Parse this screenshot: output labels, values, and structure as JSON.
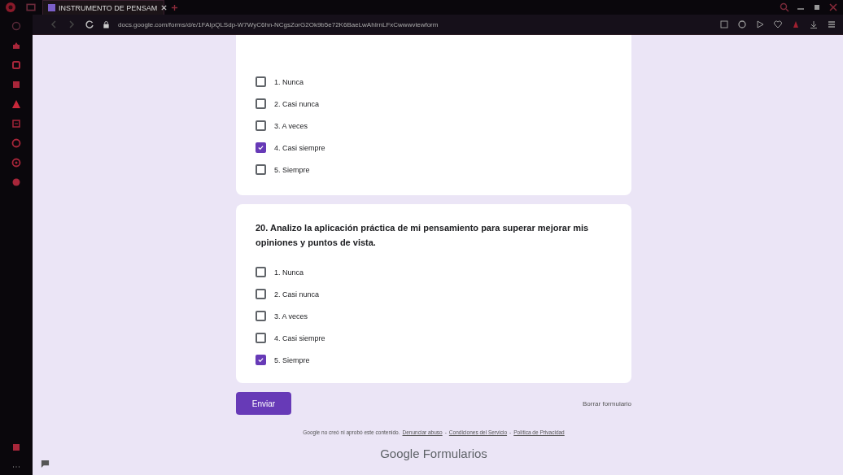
{
  "browser": {
    "tab_title": "INSTRUMENTO DE PENSAM",
    "url": "docs.google.com/forms/d/e/1FAIpQLSdp-W7WyC6hn-NCgsZorG2Ok9b5e72K6BaeLwAhIrnLFxCwwwviewform"
  },
  "questions": [
    {
      "options": [
        {
          "label": "1. Nunca",
          "checked": false
        },
        {
          "label": "2. Casi nunca",
          "checked": false
        },
        {
          "label": "3. A veces",
          "checked": false
        },
        {
          "label": "4. Casi siempre",
          "checked": true
        },
        {
          "label": "5. Siempre",
          "checked": false
        }
      ]
    },
    {
      "title": "20. Analizo la aplicación práctica de mi pensamiento para superar mejorar mis opiniones y puntos de vista.",
      "options": [
        {
          "label": "1. Nunca",
          "checked": false
        },
        {
          "label": "2. Casi nunca",
          "checked": false
        },
        {
          "label": "3. A veces",
          "checked": false
        },
        {
          "label": "4. Casi siempre",
          "checked": false
        },
        {
          "label": "5. Siempre",
          "checked": true
        }
      ]
    }
  ],
  "submit_button": "Enviar",
  "clear_link": "Borrar formulario",
  "footer": {
    "notice": "Google no creó ni aprobó este contenido.",
    "links": [
      "Denunciar abuso",
      "Condiciones del Servicio",
      "Política de Privacidad"
    ],
    "separator": "-",
    "brand": "Google Formularios"
  }
}
